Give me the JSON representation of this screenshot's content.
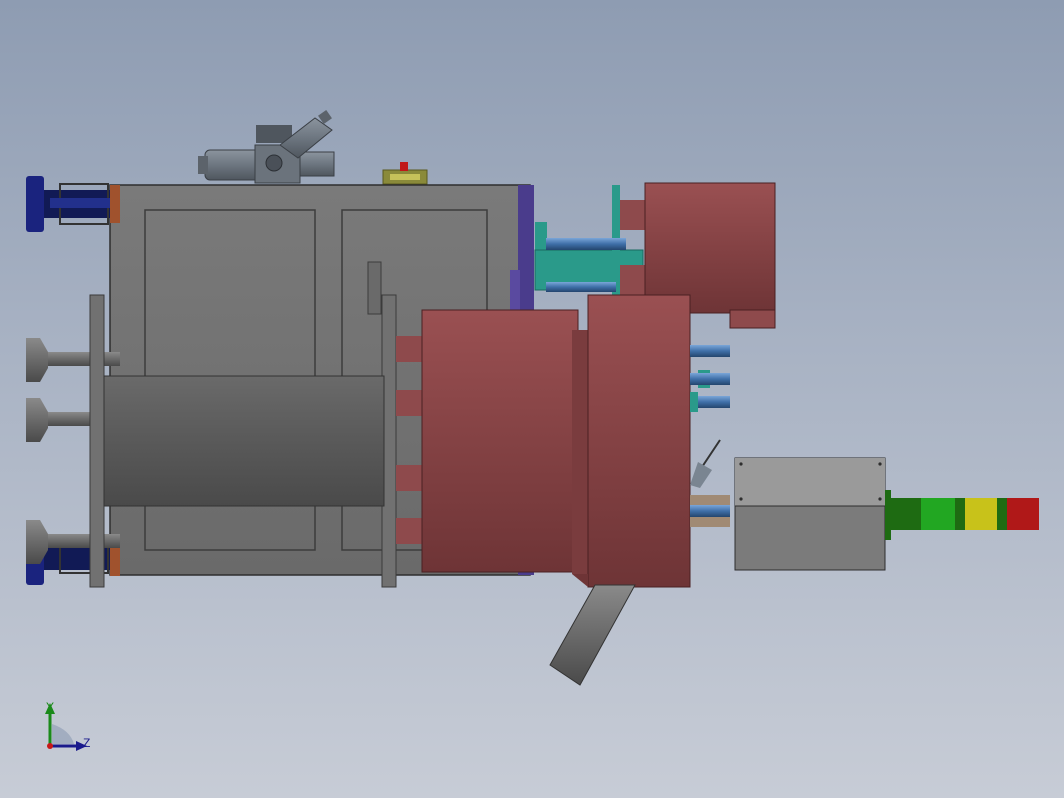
{
  "view": {
    "background_top": "#8e9cb2",
    "background_bottom": "#c7ccd6"
  },
  "colors": {
    "frame_gray": "#6e6e6e",
    "panel_gray": "#666666",
    "mold_red": "#8e4a4c",
    "handle_blue": "#1a237e",
    "cylinder_steel": "#7a8591",
    "pipe_blue": "#3f6fa8",
    "teal_bracket": "#2a9a8a",
    "stack_light_green_dark": "#1e6b12",
    "stack_light_green": "#22a722",
    "stack_light_yellow": "#c8c21a",
    "stack_light_red": "#b01818"
  },
  "triad": {
    "y_label": "Y",
    "z_label": "Z"
  }
}
